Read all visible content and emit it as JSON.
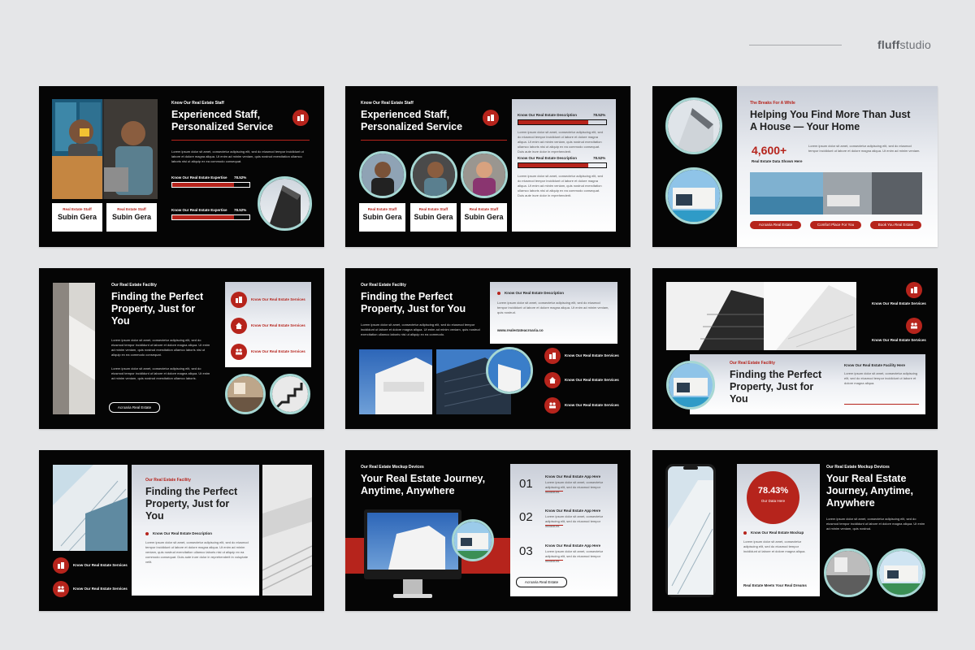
{
  "brand": {
    "name_bold": "fluff",
    "name_rest": "studio"
  },
  "colors": {
    "accent": "#b6241c",
    "ring": "#a6d7d3",
    "slide_bg": "#050505",
    "page_bg": "#e5e6e8"
  },
  "slides": {
    "s1": {
      "eyebrow": "Know Our Real Estate Staff",
      "title1": "Experienced Staff,",
      "title2": "Personalized Service",
      "para": "Lorem ipsum dolor sit amet, consectetur adipiscing elit, sed do eiusmod tempor incididunt ut labore et dolore magna aliqua. Ut enim ad minim veniam, quis nostrud exercitation ullamco laboris nisi ut aliquip ex ea commodo consequat.",
      "bar1_label": "Know Our Real Estate Expertise",
      "bar1_value": "78.52%",
      "bar1_fill": 0.8,
      "bar2_label": "Know Our Real Estate Expertise",
      "bar2_value": "78.52%",
      "bar2_fill": 0.8,
      "card1_label": "Real Estate Staff",
      "card1_name": "Subin Gera",
      "card2_label": "Real Estate Staff",
      "card2_name": "Subin Gera",
      "icon": "building-icon"
    },
    "s2": {
      "eyebrow": "Know Our Real Estate Staff",
      "title1": "Experienced Staff,",
      "title2": "Personalized Service",
      "bar1_label": "Know Our Real Estate Description",
      "bar1_value": "78.52%",
      "bar1_fill": 0.8,
      "bar2_label": "Know Our Real Estate Description",
      "bar2_value": "78.52%",
      "bar2_fill": 0.8,
      "para": "Lorem ipsum dolor sit amet, consectetur adipiscing elit, sed do eiusmod tempor incididunt ut labore et dolore magna aliqua. Ut enim ad minim veniam, quis nostrud exercitation ullamco laboris nisi ut aliquip ex ea commodo consequat. Duis aute irure dolor in reprehenderit.",
      "card1_label": "Real Estate Staff",
      "card1_name": "Subin Gera",
      "card2_label": "Real Estate Staff",
      "card2_name": "Subin Gera",
      "card3_label": "Real Estate Staff",
      "card3_name": "Subin Gera",
      "icon": "building-icon"
    },
    "s3": {
      "eyebrow": "The Breaks For A While",
      "title1": "Helping You Find More Than Just",
      "title2": "A House — Your Home",
      "stat": "4,600+",
      "stat_label": "Real Estate Data Shown Here",
      "para": "Lorem ipsum dolor sit amet, consectetur adipiscing elit, sed do eiusmod tempor incididunt ut labore et dolore magna aliqua. Ut enim ad minim veniam.",
      "btn1": "Acroaria Real Estate",
      "btn2": "Comfort Place For You",
      "btn3": "Book You Real Estate"
    },
    "s4": {
      "eyebrow": "Our Real Estate Facility",
      "title1": "Finding the Perfect",
      "title2": "Property, Just for",
      "title3": "You",
      "para1": "Lorem ipsum dolor sit amet, consectetur adipiscing elit, sed do eiusmod tempor incididunt ut labore et dolore magna aliqua. Ut enim ad minim veniam, quis nostrud exercitation ullamco laboris nisi ut aliquip ex ea commodo consequat.",
      "para2": "Lorem ipsum dolor sit amet, consectetur adipiscing elit, sed do eiusmod tempor incididunt ut labore et dolore magna aliqua. Ut enim ad minim veniam, quis nostrud exercitation ullamco laboris.",
      "button": "Acroaria Real Estate",
      "item1": "Know Our Real Estate Services",
      "item2": "Know Our Real Estate Services",
      "item3": "Know Our Real Estate Services"
    },
    "s5": {
      "eyebrow": "Our Real Estate Facility",
      "title1": "Finding the Perfect",
      "title2": "Property, Just for You",
      "para": "Lorem ipsum dolor sit amet, consectetur adipiscing elit, sed do eiusmod tempor incididunt ut labore et dolore magna aliqua. Ut enim ad minim veniam, quis nostrud exercitation ullamco laboris nisi ut aliquip ex ea commodo.",
      "panel_title": "Know Our Real Estate Description",
      "panel_para": "Lorem ipsum dolor sit amet, consectetur adipiscing elit, sed do eiusmod tempor incididunt ut labore et dolore magna aliqua. Ut enim ad minim veniam, quis nostrud.",
      "url": "www.realestateacroaria.co",
      "item1": "Know Our Real Estate Services",
      "item2": "Know Our Real Estate Services",
      "item3": "Know Our Real Estate Services"
    },
    "s6": {
      "item1": "Know Our Real Estate Services",
      "item2": "Know Our Real Estate Services",
      "eyebrow": "Our Real Estate Facility",
      "title1": "Finding the Perfect",
      "title2": "Property, Just for",
      "title3": "You",
      "side_title": "Know Our Real Estate Facility Here",
      "para": "Lorem ipsum dolor sit amet, consectetur adipiscing elit, sed do eiusmod tempor incididunt ut labore et dolore magna aliqua."
    },
    "s7": {
      "eyebrow": "Our Real Estate Facility",
      "title1": "Finding the Perfect",
      "title2": "Property, Just for",
      "title3": "You",
      "sub": "Know Our Real Estate Description",
      "para": "Lorem ipsum dolor sit amet, consectetur adipiscing elit, sed do eiusmod tempor incididunt ut labore et dolore magna aliqua. Ut enim ad minim veniam, quis nostrud exercitation ullamco laboris nisi ut aliquip ex ea commodo consequat. Duis aute irure dolor in reprehenderit in voluptate velit.",
      "item1": "Know Our Real Estate Services",
      "item2": "Know Our Real Estate Services"
    },
    "s8": {
      "eyebrow": "Our Real Estate Mockup Devices",
      "title1": "Your Real Estate Journey,",
      "title2": "Anytime, Anywhere",
      "n1": "01",
      "n1_label": "Know Our Real Estate App Here",
      "n2": "02",
      "n2_label": "Know Our Real Estate App Here",
      "n3": "03",
      "n3_label": "Know Our Real Estate App Here",
      "para": "Lorem ipsum dolor sit amet, consectetur adipiscing elit, sed do eiusmod tempor incididunt.",
      "button": "Acroaria Real Estate"
    },
    "s9": {
      "stat": "78.43%",
      "stat_label": "Our Data Here",
      "sub": "Know Our Real Estate Mockup",
      "para": "Lorem ipsum dolor sit amet, consectetur adipiscing elit, sed do eiusmod tempor incididunt ut labore et dolore magna aliqua.",
      "footer": "Real Estate Meets Your Real Dreams",
      "eyebrow": "Our Real Estate Mockup Devices",
      "title1": "Your Real Estate",
      "title2": "Journey, Anytime,",
      "title3": "Anywhere",
      "para2": "Lorem ipsum dolor sit amet, consectetur adipiscing elit, sed do eiusmod tempor incididunt ut labore et dolore magna aliqua. Ut enim ad minim veniam, quis nostrud."
    }
  }
}
